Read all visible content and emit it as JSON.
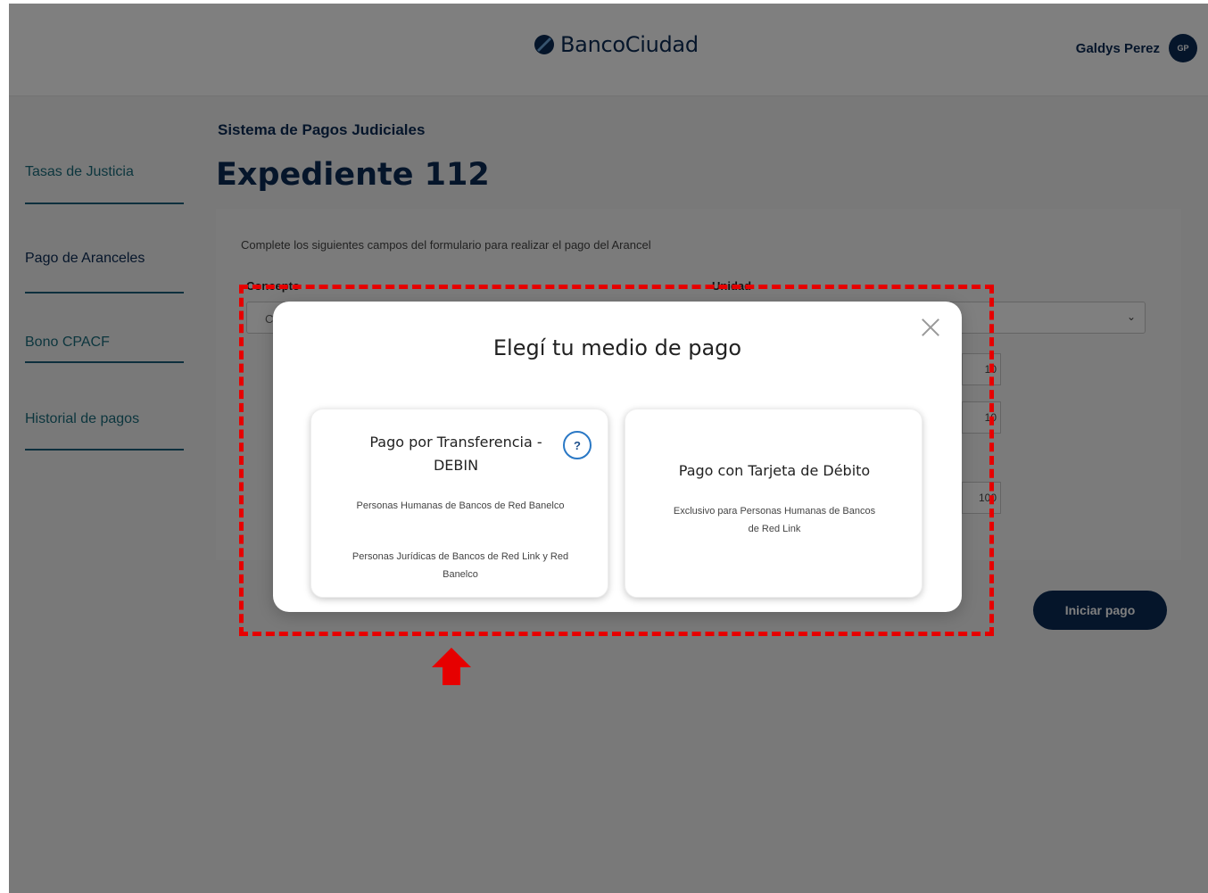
{
  "header": {
    "brand": "BancoCiudad",
    "user_name": "Galdys Perez",
    "avatar_initials": "GP"
  },
  "sidebar": {
    "items": [
      {
        "label": "Tasas de Justicia"
      },
      {
        "label": "Pago de Aranceles"
      },
      {
        "label": "Bono CPACF"
      },
      {
        "label": "Historial de pagos"
      }
    ]
  },
  "main": {
    "subtitle": "Sistema de Pagos Judiciales",
    "title": "Expediente 112",
    "form": {
      "intro": "Complete los siguientes campos del formulario para realizar el pago del Arancel",
      "concepto_label": "Concepto",
      "concepto_value": "C",
      "unidad_label": "Unidad",
      "values": [
        "10",
        "10",
        "100"
      ]
    },
    "start_button": "Iniciar pago"
  },
  "modal": {
    "title": "Elegí tu medio de pago",
    "options": [
      {
        "title": "Pago por Transferencia - DEBIN",
        "help": "?",
        "desc1": "Personas Humanas de Bancos de Red Banelco",
        "desc2": "Personas Jurídicas de Bancos de Red Link y Red Banelco"
      },
      {
        "title": "Pago con Tarjeta de Débito",
        "desc1": "Exclusivo para Personas Humanas de Bancos de Red Link"
      }
    ]
  },
  "colors": {
    "brand_navy": "#0b2a55",
    "sidebar_teal": "#1a6d7d",
    "annotation_red": "#e60000"
  }
}
